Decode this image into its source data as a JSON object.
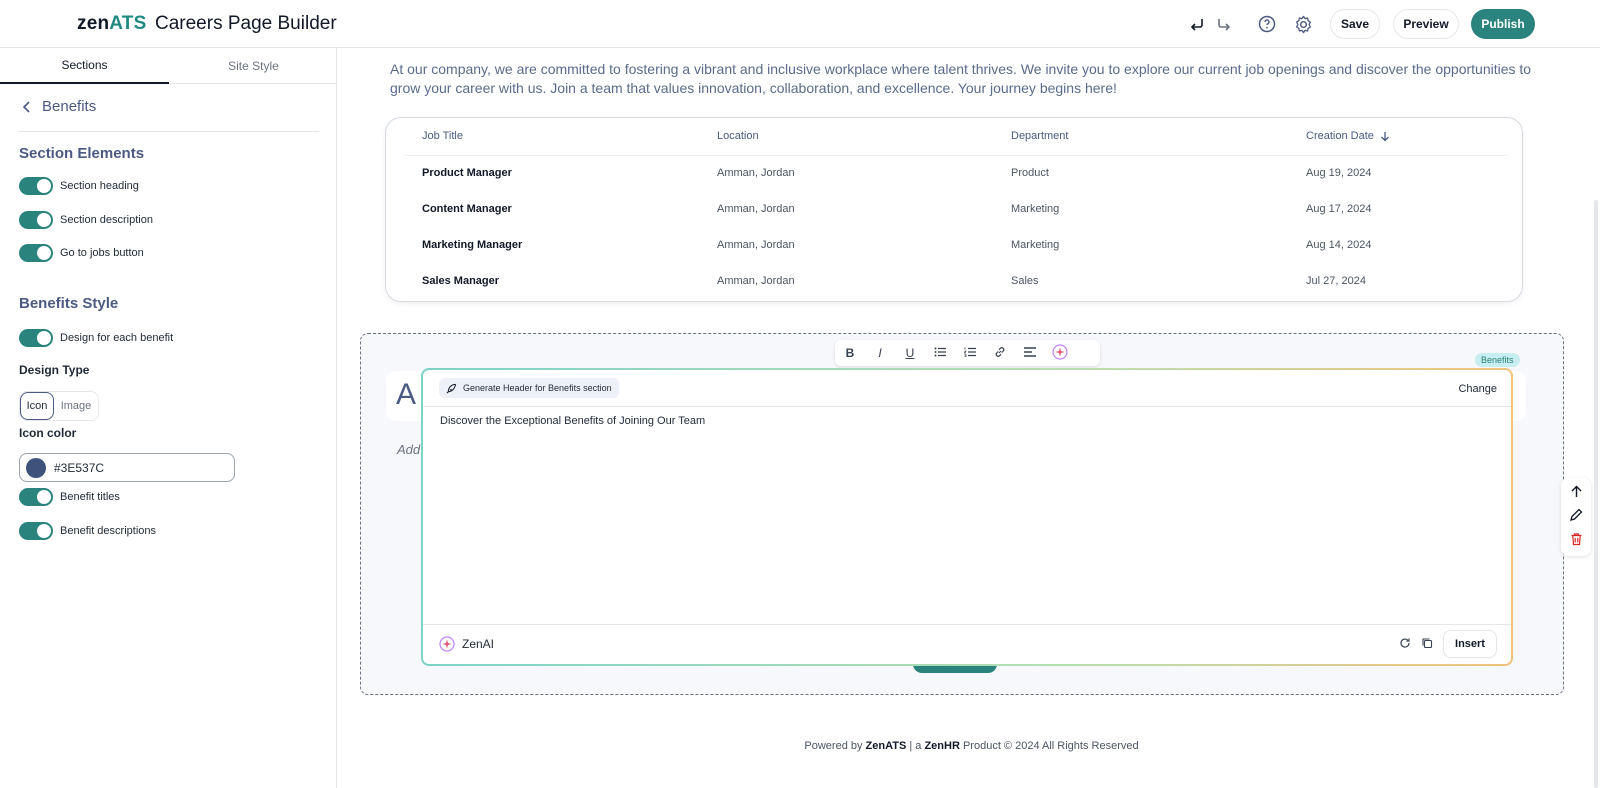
{
  "header": {
    "logo_zen": "zen",
    "logo_ats": "ATS",
    "title": "Careers Page Builder",
    "undo_icon": "undo-icon",
    "redo_icon": "redo-icon",
    "help_icon": "help-icon",
    "settings_icon": "gear-icon",
    "save_label": "Save",
    "preview_label": "Preview",
    "publish_label": "Publish",
    "accent": "#2A837C"
  },
  "sidebar": {
    "tabs": [
      {
        "label": "Sections",
        "active": true
      },
      {
        "label": "Site Style",
        "active": false
      }
    ],
    "back_label": "Benefits",
    "section_elements_heading": "Section Elements",
    "section_toggles": [
      {
        "label": "Section heading",
        "on": true
      },
      {
        "label": "Section description",
        "on": true
      },
      {
        "label": "Go to jobs button",
        "on": true
      }
    ],
    "benefits_style_heading": "Benefits Style",
    "design_each_label": "Design for each benefit",
    "design_type_label": "Design Type",
    "design_type_options": [
      "Icon",
      "Image"
    ],
    "design_type_selected": "Icon",
    "icon_color_label": "Icon color",
    "icon_color_value": "#3E537C",
    "benefit_titles_label": "Benefit titles",
    "benefit_descriptions_label": "Benefit descriptions"
  },
  "canvas": {
    "intro_text": "At our company, we are committed to fostering a vibrant and inclusive workplace where talent thrives. We invite you to explore our current job openings and discover the opportunities to grow your career with us. Join a team that values innovation, collaboration, and excellence. Your journey begins here!",
    "jobs_table": {
      "columns": [
        "Job Title",
        "Location",
        "Department",
        "Creation Date"
      ],
      "rows": [
        [
          "Product Manager",
          "Amman, Jordan",
          "Product",
          "Aug 19, 2024"
        ],
        [
          "Content Manager",
          "Amman, Jordan",
          "Marketing",
          "Aug 17, 2024"
        ],
        [
          "Marketing Manager",
          "Amman, Jordan",
          "Marketing",
          "Aug 14, 2024"
        ],
        [
          "Sales Manager",
          "Amman, Jordan",
          "Sales",
          "Jul 27, 2024"
        ]
      ]
    },
    "benefits_badge": "Benefits",
    "heading_peek": "A",
    "description_peek": "Add"
  },
  "toolbar": {
    "bold": "B",
    "italic": "I",
    "underline": "U"
  },
  "ai_panel": {
    "prompt_chip": "Generate Header for Benefits section",
    "change_label": "Change",
    "generated_text": "Discover the Exceptional Benefits of Joining Our Team",
    "brand": "ZenAI",
    "insert_label": "Insert"
  },
  "footer": {
    "powered_by": "Powered by",
    "brand1": "ZenATS",
    "mid": "| a",
    "brand2": "ZenHR",
    "tail": "Product © 2024 All Rights Reserved"
  }
}
